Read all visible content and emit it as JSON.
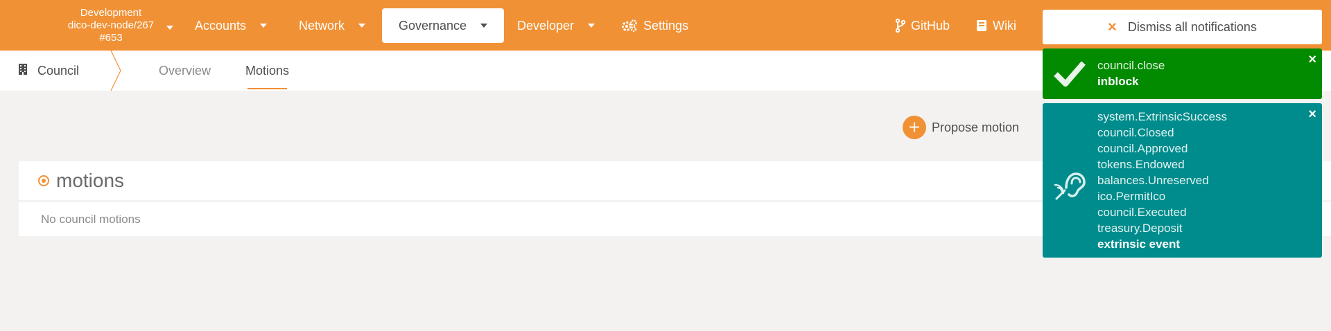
{
  "topbar": {
    "chain": {
      "line1": "Development",
      "line2": "dico-dev-node/267",
      "line3": "#653"
    },
    "menu": {
      "accounts": "Accounts",
      "network": "Network",
      "governance": "Governance",
      "developer": "Developer",
      "settings": "Settings",
      "github": "GitHub",
      "wiki": "Wiki"
    }
  },
  "subnav": {
    "section": "Council",
    "tabs": {
      "overview": "Overview",
      "motions": "Motions"
    }
  },
  "content": {
    "propose_label": "Propose motion",
    "card_title": "motions",
    "empty_text": "No council motions"
  },
  "notifications": {
    "dismiss_all": "Dismiss all notifications",
    "close_symbol": "×",
    "first": {
      "line1": "council.close",
      "status": "inblock"
    },
    "second": {
      "events": [
        "system.ExtrinsicSuccess",
        "council.Closed",
        "council.Approved",
        "tokens.Endowed",
        "balances.Unreserved",
        "ico.PermitIco",
        "council.Executed",
        "treasury.Deposit"
      ],
      "status": "extrinsic event"
    }
  },
  "colors": {
    "brand": "#f19135",
    "success": "#028b00",
    "info": "#008c8c",
    "background": "#f3f2f1"
  }
}
